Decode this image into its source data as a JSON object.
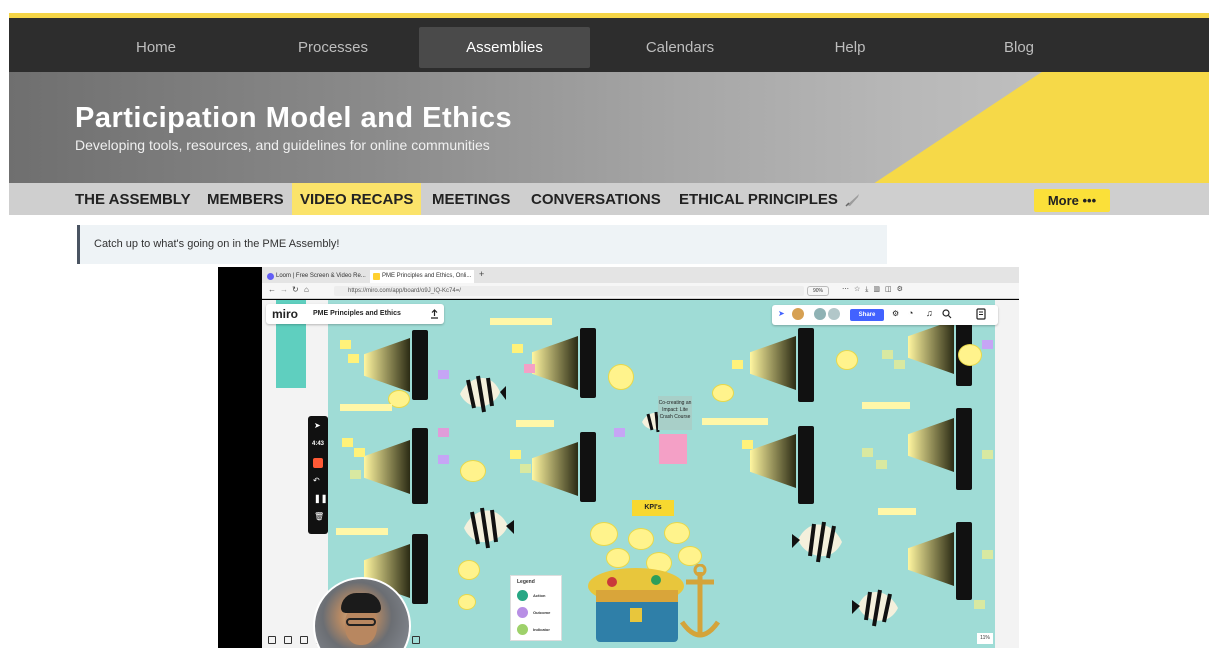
{
  "topnav": {
    "items": [
      {
        "label": "Home"
      },
      {
        "label": "Processes"
      },
      {
        "label": "Assemblies",
        "active": true
      },
      {
        "label": "Calendars"
      },
      {
        "label": "Help"
      },
      {
        "label": "Blog"
      }
    ]
  },
  "hero": {
    "title": "Participation Model and Ethics",
    "subtitle": "Developing tools, resources, and guidelines for online communities"
  },
  "tabs": {
    "items": [
      {
        "label": "THE ASSEMBLY"
      },
      {
        "label": "MEMBERS"
      },
      {
        "label": "VIDEO RECAPS",
        "active": true
      },
      {
        "label": "MEETINGS"
      },
      {
        "label": "CONVERSATIONS"
      },
      {
        "label": "ETHICAL PRINCIPLES"
      }
    ],
    "more_label": "More •••"
  },
  "notice": {
    "text": "Catch up to what's going on in the PME Assembly!"
  },
  "video": {
    "browser_tabs": [
      {
        "label": "Loom | Free Screen & Video Re..."
      },
      {
        "label": "PME Principles and Ethics, Onli..."
      }
    ],
    "url": "https://miro.com/app/board/o9J_lQ-Kc74=/",
    "browser_zoom": "90%",
    "miro_logo": "miro",
    "board_name": "PME Principles and Ethics",
    "share_label": "Share",
    "timer": "4:43",
    "kpi_label": "KPI's",
    "cocreate_text": "Co-creating an Impact: Lite Crash Course",
    "legend": {
      "title": "Legend",
      "items": [
        {
          "label": "Action",
          "color": "#27a784"
        },
        {
          "label": "Outcome",
          "color": "#b88ee5"
        },
        {
          "label": "Indicator",
          "color": "#9ed16a"
        }
      ]
    },
    "board_zoom": "11%",
    "colors": {
      "board_bg": "#9fdcd6",
      "yellow": "#f6d948",
      "accent_blue": "#4262ff"
    }
  }
}
